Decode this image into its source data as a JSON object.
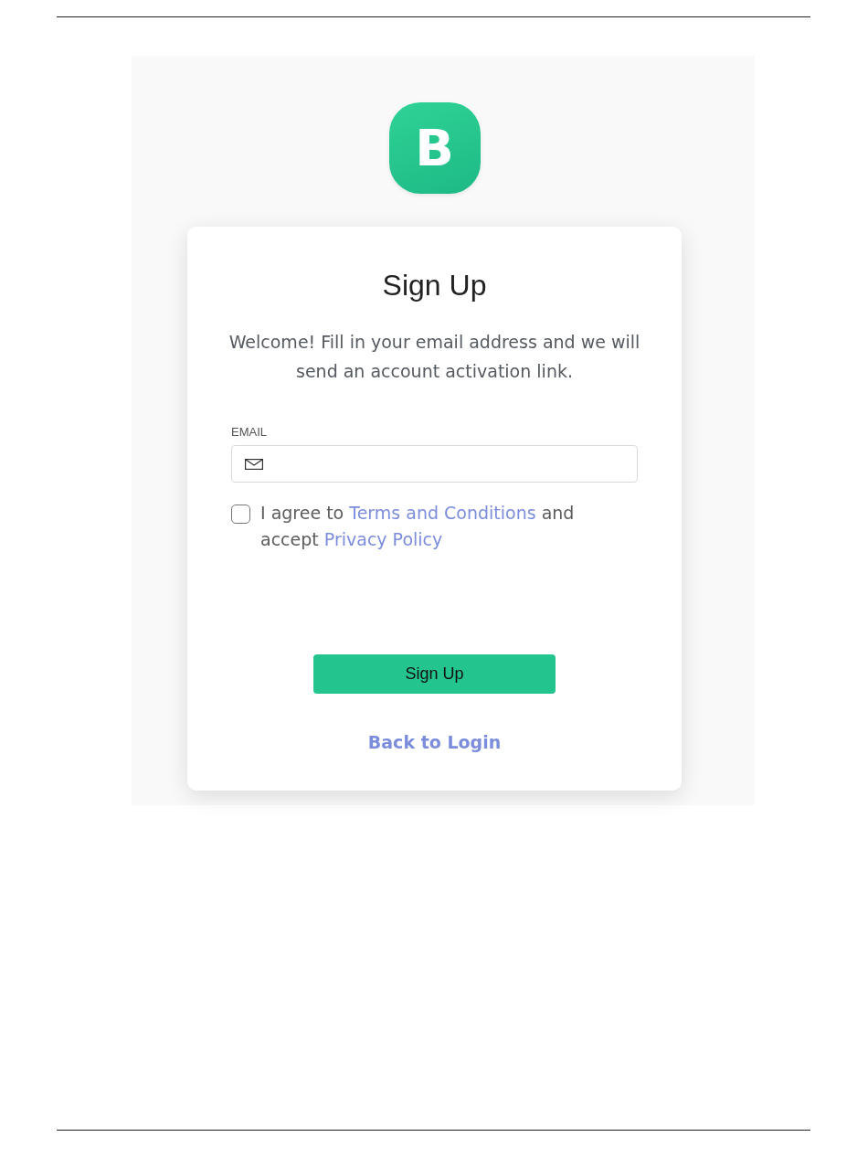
{
  "logo": {
    "letter": "B"
  },
  "card": {
    "title": "Sign Up",
    "intro": "Welcome! Fill in your email address and we will send an account activation link.",
    "email": {
      "label": "EMAIL"
    },
    "agreement": {
      "checked": false,
      "parts": [
        {
          "kind": "text",
          "text": "I agree to "
        },
        {
          "kind": "link",
          "text": "Terms and Conditions"
        },
        {
          "kind": "text",
          "text": " and accept "
        },
        {
          "kind": "link",
          "text": "Privacy Policy"
        }
      ]
    },
    "submit": {
      "label": "Sign Up"
    },
    "back_link": {
      "label": "Back to Login"
    }
  }
}
